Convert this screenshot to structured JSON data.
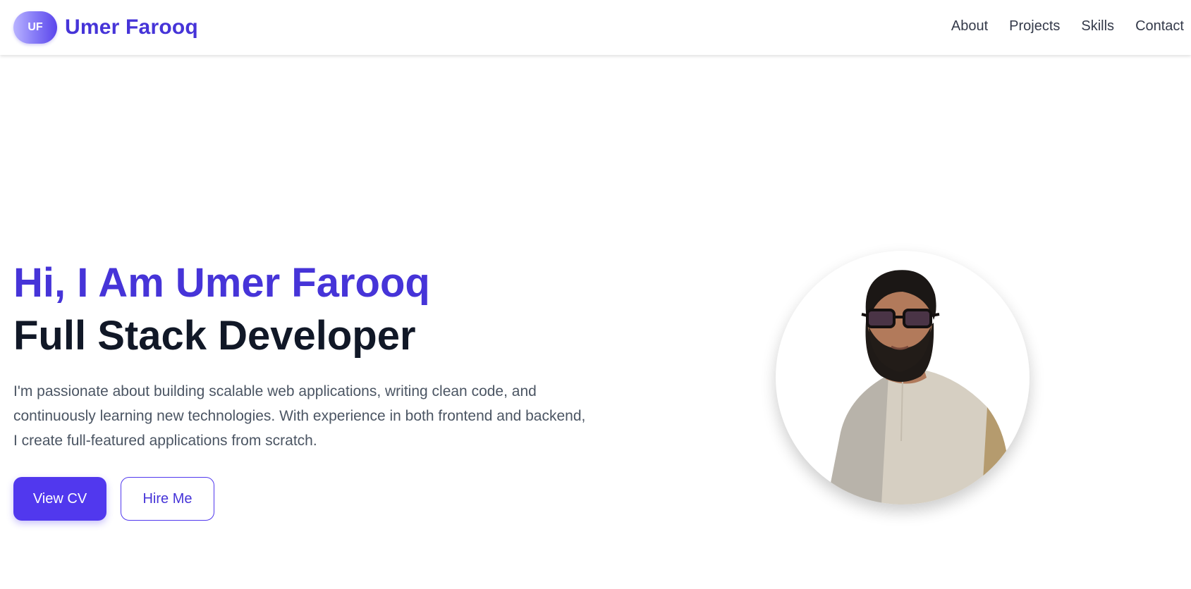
{
  "brand": {
    "initials": "UF",
    "name": "Umer Farooq"
  },
  "nav": {
    "links": [
      "About",
      "Projects",
      "Skills",
      "Contact"
    ]
  },
  "hero": {
    "greeting": "Hi, I Am Umer Farooq",
    "role": "Full Stack Developer",
    "description": "I'm passionate about building scalable web applications, writing clean code, and continuously learning new technologies. With experience in both frontend and backend, I create full-featured applications from scratch.",
    "buttons": {
      "primary": "View CV",
      "secondary": "Hire Me"
    }
  },
  "colors": {
    "accent": "#4634d8",
    "button": "#5138ee",
    "heading_dark": "#111827",
    "body_text": "#4b5563"
  },
  "icons": {
    "profile": "profile-photo"
  }
}
